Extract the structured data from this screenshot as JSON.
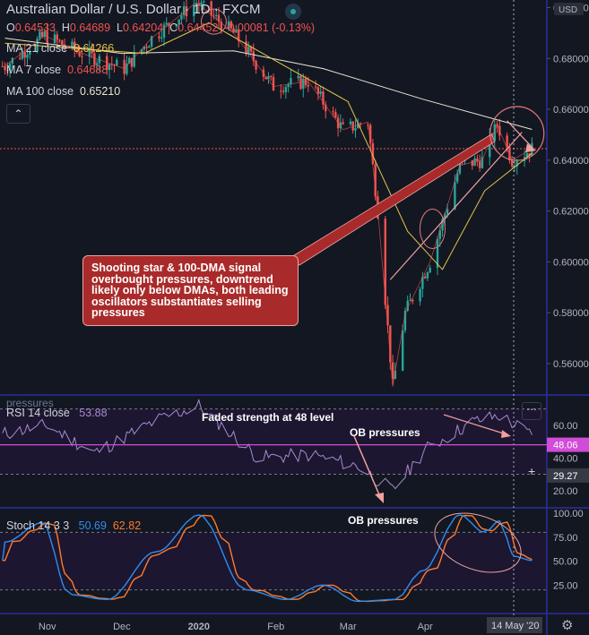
{
  "header": {
    "title": "Australian Dollar / U.S. Dollar",
    "interval": "1D",
    "source": "FXCM",
    "ohlc": {
      "o_label": "O",
      "o": "0.64533",
      "h_label": "H",
      "h": "0.64689",
      "l_label": "L",
      "l": "0.64204",
      "c_label": "C",
      "c": "0.64452",
      "change": "-0.00081 (-0.13%)"
    },
    "ma21": {
      "label": "MA 21 close",
      "value": "0.64266"
    },
    "ma7": {
      "label": "MA 7 close",
      "value": "0.64688"
    },
    "ma100": {
      "label": "MA 100 close",
      "value": "0.65210"
    },
    "expand_icon": "chevron-up-icon"
  },
  "currency_badge": "USD",
  "annotations": {
    "callout": "Shooting star & 100-DMA signal overbought pressures, downtrend likely only below DMAs, both leading oscillators substantiates selling pressures",
    "rsi_note": "Faded strength at 48 level",
    "rsi_ob": "OB pressures",
    "stoch_ob": "OB pressures",
    "rsi_overlap": "pressures"
  },
  "rsi": {
    "label": "RSI 14 close",
    "value": "53.88",
    "badge_value": "48.06",
    "badge2_value": "29.27",
    "more_icon": "more-icon",
    "plus_icon": "plus-icon"
  },
  "stoch": {
    "label": "Stoch 14 3 3",
    "k": "50.69",
    "d": "62.82"
  },
  "x_axis": {
    "labels": [
      "Nov",
      "Dec",
      "2020",
      "Feb",
      "Mar",
      "Apr",
      "Ma"
    ],
    "date_badge": "14 May '20"
  },
  "colors": {
    "up": "#26a69a",
    "down": "#ef5350",
    "ma21": "#e5c44a",
    "ma7": "#ef5350",
    "ma100": "#e8e6d2",
    "rsi": "#a78bd0",
    "stoch_k": "#2f8df0",
    "stoch_d": "#ff7a2a",
    "callout": "#a92a2a",
    "price_line": "#ef5350"
  },
  "chart_data": [
    {
      "type": "candlestick",
      "title": "Australian Dollar / U.S. Dollar, 1D, FXCM",
      "y_tick_labels": [
        "0.70000",
        "0.68000",
        "0.66000",
        "0.64000",
        "0.62000",
        "0.60000",
        "0.58000",
        "0.56000"
      ],
      "ylim": [
        0.548,
        0.703
      ],
      "x_range": [
        "2019-10-13",
        "2020-05-20"
      ],
      "key_points": [
        {
          "x": "2019-10-15",
          "y": 0.677
        },
        {
          "x": "2019-10-31",
          "y": 0.689
        },
        {
          "x": "2019-11-15",
          "y": 0.682
        },
        {
          "x": "2019-12-02",
          "y": 0.676
        },
        {
          "x": "2019-12-13",
          "y": 0.688
        },
        {
          "x": "2019-12-31",
          "y": 0.702
        },
        {
          "x": "2020-01-15",
          "y": 0.69
        },
        {
          "x": "2020-01-31",
          "y": 0.669
        },
        {
          "x": "2020-02-14",
          "y": 0.671
        },
        {
          "x": "2020-02-28",
          "y": 0.652
        },
        {
          "x": "2020-03-09",
          "y": 0.655
        },
        {
          "x": "2020-03-13",
          "y": 0.62
        },
        {
          "x": "2020-03-19",
          "y": 0.551
        },
        {
          "x": "2020-03-24",
          "y": 0.58
        },
        {
          "x": "2020-04-03",
          "y": 0.6
        },
        {
          "x": "2020-04-15",
          "y": 0.638
        },
        {
          "x": "2020-04-24",
          "y": 0.64
        },
        {
          "x": "2020-04-30",
          "y": 0.654
        },
        {
          "x": "2020-05-06",
          "y": 0.64
        },
        {
          "x": "2020-05-14",
          "y": 0.6445
        }
      ],
      "series": [
        {
          "name": "MA 21 close",
          "last": 0.64266,
          "points": [
            [
              "2019-10-15",
              0.686
            ],
            [
              "2019-12-10",
              0.682
            ],
            [
              "2020-01-05",
              0.694
            ],
            [
              "2020-02-01",
              0.679
            ],
            [
              "2020-03-01",
              0.663
            ],
            [
              "2020-03-25",
              0.612
            ],
            [
              "2020-04-08",
              0.597
            ],
            [
              "2020-04-25",
              0.628
            ],
            [
              "2020-05-14",
              0.6427
            ]
          ]
        },
        {
          "name": "MA 100 close",
          "last": 0.6521,
          "points": [
            [
              "2019-10-15",
              0.688
            ],
            [
              "2019-12-01",
              0.682
            ],
            [
              "2020-01-15",
              0.683
            ],
            [
              "2020-02-20",
              0.676
            ],
            [
              "2020-03-31",
              0.664
            ],
            [
              "2020-05-14",
              0.6521
            ]
          ]
        },
        {
          "name": "MA 7 close",
          "last": 0.64688
        }
      ],
      "current_price": 0.64452,
      "trendline": [
        [
          "2020-03-18",
          0.593
        ],
        [
          "2020-05-10",
          0.651
        ]
      ]
    },
    {
      "type": "line",
      "title": "RSI 14 close",
      "y_tick_labels": [
        "60.00",
        "40.00",
        "20.00"
      ],
      "ylim": [
        10,
        78
      ],
      "levels": [
        70,
        30
      ],
      "current": 53.88,
      "marked_level": 48.06,
      "points": [
        [
          "2019-10-15",
          55
        ],
        [
          "2019-11-01",
          60
        ],
        [
          "2019-11-20",
          43
        ],
        [
          "2019-12-15",
          63
        ],
        [
          "2020-01-01",
          72
        ],
        [
          "2020-01-25",
          40
        ],
        [
          "2020-02-15",
          42
        ],
        [
          "2020-03-05",
          35
        ],
        [
          "2020-03-19",
          20
        ],
        [
          "2020-04-01",
          45
        ],
        [
          "2020-04-20",
          62
        ],
        [
          "2020-05-01",
          66
        ],
        [
          "2020-05-14",
          53.9
        ]
      ]
    },
    {
      "type": "line",
      "title": "Stoch 14 3 3",
      "y_tick_labels": [
        "100.00",
        "75.00",
        "50.00",
        "25.00"
      ],
      "ylim": [
        0,
        100
      ],
      "levels": [
        80,
        20
      ],
      "series": [
        {
          "name": "%K",
          "last": 50.69,
          "points": [
            [
              "2019-10-15",
              70
            ],
            [
              "2019-10-30",
              90
            ],
            [
              "2019-11-10",
              15
            ],
            [
              "2019-11-25",
              10
            ],
            [
              "2019-12-15",
              60
            ],
            [
              "2020-01-01",
              98
            ],
            [
              "2020-01-20",
              20
            ],
            [
              "2020-02-05",
              10
            ],
            [
              "2020-02-20",
              25
            ],
            [
              "2020-03-05",
              8
            ],
            [
              "2020-03-20",
              10
            ],
            [
              "2020-03-31",
              40
            ],
            [
              "2020-04-15",
              98
            ],
            [
              "2020-04-25",
              80
            ],
            [
              "2020-05-01",
              92
            ],
            [
              "2020-05-07",
              55
            ],
            [
              "2020-05-14",
              50.7
            ]
          ]
        },
        {
          "name": "%D",
          "last": 62.82
        }
      ]
    }
  ]
}
